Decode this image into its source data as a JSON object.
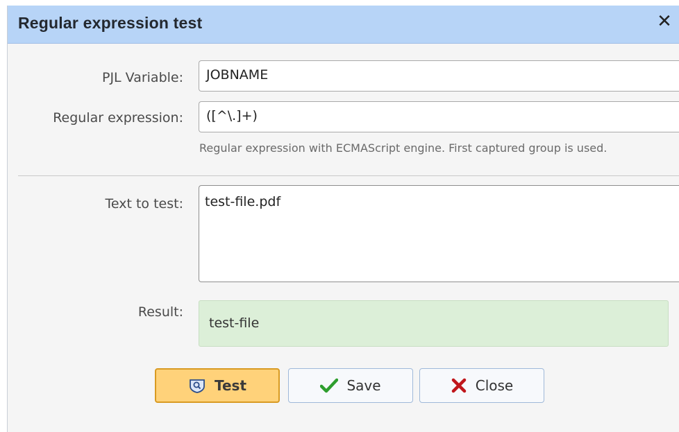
{
  "dialog": {
    "title": "Regular expression test",
    "close_glyph": "✕"
  },
  "form": {
    "pjl_variable": {
      "label": "PJL Variable:",
      "value": "JOBNAME"
    },
    "regular_expression": {
      "label": "Regular expression:",
      "value": "([^\\.]+)",
      "hint": "Regular expression with ECMAScript engine. First captured group is used."
    },
    "text_to_test": {
      "label": "Text to test:",
      "value": "test-file.pdf"
    },
    "result": {
      "label": "Result:",
      "value": "test-file",
      "background": "#dcefd8"
    }
  },
  "buttons": {
    "test": {
      "label": "Test",
      "icon": "search-shield-icon",
      "accent": "#ffd27a"
    },
    "save": {
      "label": "Save",
      "icon": "checkmark-icon",
      "icon_color": "#2e9e2e"
    },
    "close": {
      "label": "Close",
      "icon": "red-x-icon",
      "icon_color": "#c0161b"
    }
  },
  "colors": {
    "titlebar": "#b7d4f7",
    "dialog_bg": "#f5f5f5"
  }
}
